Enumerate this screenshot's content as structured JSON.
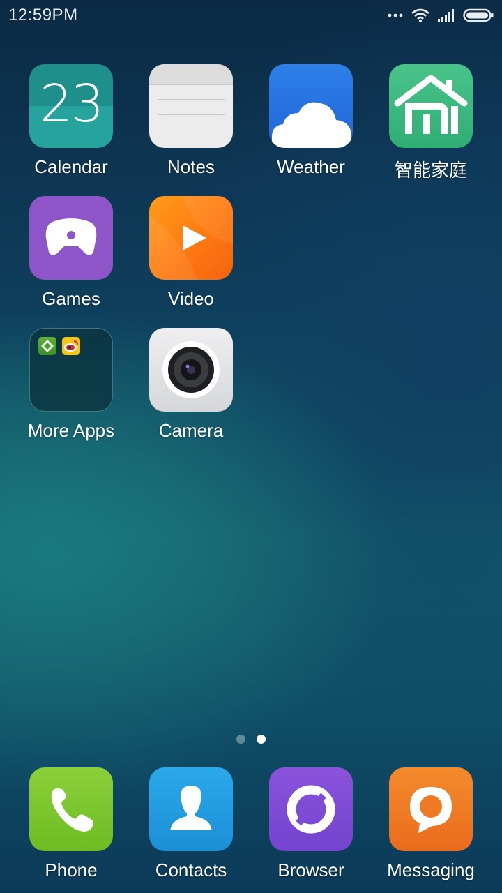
{
  "status_bar": {
    "time": "12:59PM",
    "icons": [
      "more-dots-icon",
      "wifi-icon",
      "signal-icon",
      "battery-icon"
    ]
  },
  "home": {
    "apps": [
      {
        "label": "Calendar",
        "icon": "calendar-icon",
        "date": "23"
      },
      {
        "label": "Notes",
        "icon": "notes-icon"
      },
      {
        "label": "Weather",
        "icon": "weather-icon"
      },
      {
        "label": "智能家庭",
        "icon": "smart-home-icon"
      },
      {
        "label": "Games",
        "icon": "games-icon"
      },
      {
        "label": "Video",
        "icon": "video-icon"
      },
      {
        "label": "More Apps",
        "icon": "folder-icon"
      },
      {
        "label": "Camera",
        "icon": "camera-icon"
      }
    ],
    "page_indicator": {
      "count": 2,
      "active": 2
    }
  },
  "dock": {
    "apps": [
      {
        "label": "Phone",
        "icon": "phone-icon"
      },
      {
        "label": "Contacts",
        "icon": "contacts-icon"
      },
      {
        "label": "Browser",
        "icon": "browser-icon"
      },
      {
        "label": "Messaging",
        "icon": "messaging-icon"
      }
    ]
  },
  "colors": {
    "calendar": "#1f8f8c",
    "weather": "#2f7fe8",
    "smart_home": "#49c38a",
    "games": "#8e55c9",
    "video": "#ff7a12",
    "phone": "#7cc62e",
    "contacts": "#23a0e2",
    "browser": "#7f4bd6",
    "messaging": "#ee7a24"
  }
}
